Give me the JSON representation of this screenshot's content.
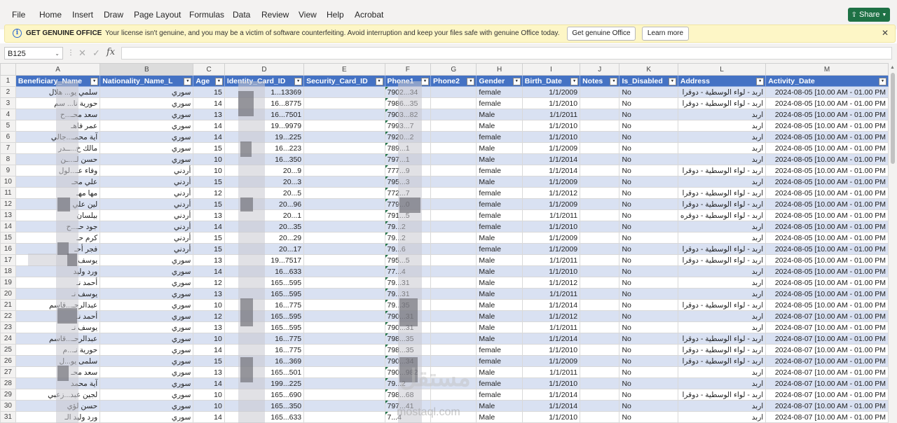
{
  "menu": [
    "File",
    "Home",
    "Insert",
    "Draw",
    "Page Layout",
    "Formulas",
    "Data",
    "Review",
    "View",
    "Help",
    "Acrobat"
  ],
  "share_label": "Share",
  "share_icon": "share-icon",
  "notice": {
    "title": "GET GENUINE OFFICE",
    "message": "Your license isn't genuine, and you may be a victim of software counterfeiting. Avoid interruption and keep your files safe with genuine Office today.",
    "button_genuine": "Get genuine Office",
    "button_learn": "Learn more",
    "close_glyph": "✕"
  },
  "formula_bar": {
    "name_box": "B125",
    "fx": "fx",
    "value": ""
  },
  "column_letters": [
    "A",
    "B",
    "C",
    "D",
    "E",
    "F",
    "G",
    "H",
    "I",
    "J",
    "K",
    "L",
    "M"
  ],
  "headers": [
    "Beneficiary_Name",
    "Nationality_Name_L",
    "Age",
    "Identity_Card_ID",
    "Security_Card_ID",
    "Phone1",
    "Phone2",
    "Gender",
    "Birth_Date",
    "Notes",
    "Is_Disabled",
    "Address",
    "Activity_Date"
  ],
  "rows": [
    [
      "2",
      "سلمي يو... هلال",
      "سوري",
      "15",
      "1...13369",
      "",
      "7902...34",
      "",
      "female",
      "1/1/2009",
      "",
      "No",
      "اربد - لواء الوسطية - دوقرا",
      "2024-08-05 [10.00 AM - 01.00 PM"
    ],
    [
      "3",
      "حورية نا... سم",
      "سوري",
      "14",
      "16...8775",
      "",
      "7986...35",
      "",
      "female",
      "1/1/2010",
      "",
      "No",
      "اربد - لواء الوسطية - دوقرا",
      "2024-08-05 [10.00 AM - 01.00 PM"
    ],
    [
      "4",
      "سعد محـ...ح",
      "سوري",
      "13",
      "16...7501",
      "",
      "7903...82",
      "",
      "Male",
      "1/1/2011",
      "",
      "No",
      "اربد",
      "2024-08-05 [10.00 AM - 01.00 PM"
    ],
    [
      "5",
      "عمر فاهـ",
      "سوري",
      "14",
      "19...9979",
      "",
      "7993...7",
      "",
      "Male",
      "1/1/2010",
      "",
      "No",
      "اربد",
      "2024-08-05 [10.00 AM - 01.00 PM"
    ],
    [
      "6",
      "آية محمـ...جالي",
      "سوري",
      "14",
      "19...225",
      "",
      "7920...2",
      "",
      "female",
      "1/1/2010",
      "",
      "No",
      "اربد",
      "2024-08-05 [10.00 AM - 01.00 PM"
    ],
    [
      "7",
      "مالك خ...ــدر",
      "سوري",
      "15",
      "16...223",
      "",
      "789...1",
      "",
      "Male",
      "1/1/2009",
      "",
      "No",
      "اربد",
      "2024-08-05 [10.00 AM - 01.00 PM"
    ],
    [
      "8",
      "حسن لـ...ـن",
      "سوري",
      "10",
      "16...350",
      "",
      "797...1",
      "",
      "Male",
      "1/1/2014",
      "",
      "No",
      "اربد",
      "2024-08-05 [10.00 AM - 01.00 PM"
    ],
    [
      "9",
      "وفاء عـ...لول",
      "أردني",
      "10",
      "20...9",
      "",
      "777...9",
      "",
      "female",
      "1/1/2014",
      "",
      "No",
      "اربد - لواء الوسطية - دوقرا",
      "2024-08-05 [10.00 AM - 01.00 PM"
    ],
    [
      "10",
      "علي محـ",
      "أردني",
      "15",
      "20...3",
      "",
      "795...3",
      "",
      "Male",
      "1/1/2009",
      "",
      "No",
      "اربد",
      "2024-08-05 [10.00 AM - 01.00 PM"
    ],
    [
      "11",
      "مها مهـ",
      "أردني",
      "12",
      "20...5",
      "",
      "772...7",
      "",
      "female",
      "1/1/2012",
      "",
      "No",
      "اربد - لواء الوسطية - دوقرا",
      "2024-08-05 [10.00 AM - 01.00 PM"
    ],
    [
      "12",
      "لين علي",
      "أردني",
      "15",
      "20...96",
      "",
      "779...0",
      "",
      "female",
      "1/1/2009",
      "",
      "No",
      "اربد - لواء الوسطية - دوقرا",
      "2024-08-05 [10.00 AM - 01.00 PM"
    ],
    [
      "13",
      "بيلسان",
      "أردني",
      "13",
      "20...1",
      "",
      "791...5",
      "",
      "female",
      "1/1/2011",
      "",
      "No",
      "اربد - لواء الوسطية - دوقره",
      "2024-08-05 [10.00 AM - 01.00 PM"
    ],
    [
      "14",
      "جود حـ...ح",
      "أردني",
      "14",
      "20...35",
      "",
      "79...2",
      "",
      "female",
      "1/1/2010",
      "",
      "No",
      "اربد",
      "2024-08-05 [10.00 AM - 01.00 PM"
    ],
    [
      "15",
      "كرم حـ",
      "أردني",
      "15",
      "20...29",
      "",
      "79...2",
      "",
      "Male",
      "1/1/2009",
      "",
      "No",
      "اربد",
      "2024-08-05 [10.00 AM - 01.00 PM"
    ],
    [
      "16",
      "فجر أحـ",
      "أردني",
      "15",
      "20...17",
      "",
      "79...6",
      "",
      "female",
      "1/1/2009",
      "",
      "No",
      "اربد - لواء الوسطية - دوقرا",
      "2024-08-05 [10.00 AM - 01.00 PM"
    ],
    [
      "17",
      "يوسف",
      "سوري",
      "13",
      "19...7517",
      "",
      "795...5",
      "",
      "Male",
      "1/1/2011",
      "",
      "No",
      "اربد - لواء الوسطية - دوقرا",
      "2024-08-05 [10.00 AM - 01.00 PM"
    ],
    [
      "18",
      "ورد وليد",
      "سوري",
      "14",
      "16...633",
      "",
      "77...4",
      "",
      "Male",
      "1/1/2010",
      "",
      "No",
      "اربد",
      "2024-08-05 [10.00 AM - 01.00 PM"
    ],
    [
      "19",
      "أحمد نـ",
      "سوري",
      "12",
      "165...595",
      "",
      "79...31",
      "",
      "Male",
      "1/1/2012",
      "",
      "No",
      "اربد",
      "2024-08-05 [10.00 AM - 01.00 PM"
    ],
    [
      "20",
      "يوسف نـ",
      "سوري",
      "13",
      "165...595",
      "",
      "79...31",
      "",
      "Male",
      "1/1/2011",
      "",
      "No",
      "اربد",
      "2024-08-05 [10.00 AM - 01.00 PM"
    ],
    [
      "21",
      "عبدالرحـ...قاسم",
      "سوري",
      "10",
      "16...775",
      "",
      "79...35",
      "",
      "Male",
      "1/1/2014",
      "",
      "No",
      "اربد - لواء الوسطية - دوقرا",
      "2024-08-05 [10.00 AM - 01.00 PM"
    ],
    [
      "22",
      "أحمد نـ",
      "سوري",
      "12",
      "165...595",
      "",
      "790...31",
      "",
      "Male",
      "1/1/2012",
      "",
      "No",
      "اربد",
      "2024-08-07 [10.00 AM - 01.00 PM"
    ],
    [
      "23",
      "يوسف نـ",
      "سوري",
      "13",
      "165...595",
      "",
      "790...31",
      "",
      "Male",
      "1/1/2011",
      "",
      "No",
      "اربد",
      "2024-08-07 [10.00 AM - 01.00 PM"
    ],
    [
      "24",
      "عبدالرحـ...قاسم",
      "سوري",
      "10",
      "16...775",
      "",
      "798...35",
      "",
      "Male",
      "1/1/2014",
      "",
      "No",
      "اربد - لواء الوسطية - دوقرا",
      "2024-08-07 [10.00 AM - 01.00 PM"
    ],
    [
      "25",
      "حورية نـ...م",
      "سوري",
      "14",
      "16...775",
      "",
      "798...35",
      "",
      "female",
      "1/1/2010",
      "",
      "No",
      "اربد - لواء الوسطية - دوقرا",
      "2024-08-07 [10.00 AM - 01.00 PM"
    ],
    [
      "26",
      "سلمى يو...ل",
      "سوري",
      "15",
      "16...369",
      "",
      "790...34",
      "",
      "female",
      "1/1/2009",
      "",
      "No",
      "اربد - لواء الوسطية - دوقرا",
      "2024-08-07 [10.00 AM - 01.00 PM"
    ],
    [
      "27",
      "سعد محـ",
      "سوري",
      "13",
      "165...501",
      "",
      "790...982",
      "",
      "Male",
      "1/1/2011",
      "",
      "No",
      "اربد",
      "2024-08-07 [10.00 AM - 01.00 PM"
    ],
    [
      "28",
      "آية محمد",
      "سوري",
      "14",
      "199...225",
      "",
      "79...2",
      "",
      "female",
      "1/1/2010",
      "",
      "No",
      "اربد",
      "2024-08-07 [10.00 AM - 01.00 PM"
    ],
    [
      "29",
      "لجين عبد...زعبي",
      "سوري",
      "10",
      "165...690",
      "",
      "798...68",
      "",
      "female",
      "1/1/2014",
      "",
      "No",
      "اربد - لواء الوسطية - دوقرا",
      "2024-08-07 [10.00 AM - 01.00 PM"
    ],
    [
      "30",
      "حسن لؤي",
      "سوري",
      "10",
      "165...350",
      "",
      "797...41",
      "",
      "Male",
      "1/1/2014",
      "",
      "No",
      "اربد",
      "2024-08-07 [10.00 AM - 01.00 PM"
    ],
    [
      "31",
      "ورد وليد الـ",
      "سوري",
      "14",
      "165...633",
      "",
      "7...4",
      "",
      "Male",
      "1/1/2010",
      "",
      "No",
      "اربد",
      "2024-08-07 [10.00 AM - 01.00 PM"
    ]
  ],
  "watermark": "مستقل",
  "watermark_sub": "mostaql.com"
}
